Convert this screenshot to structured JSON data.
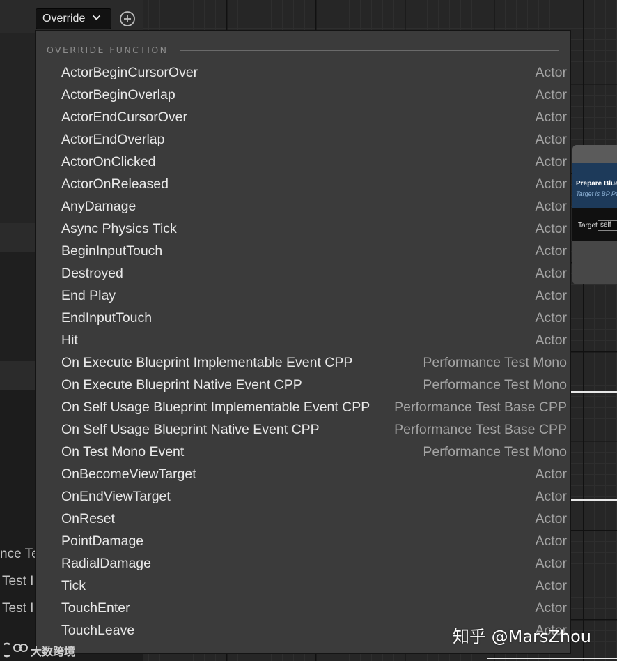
{
  "toolbar": {
    "override_label": "Override"
  },
  "menu": {
    "header": "OVERRIDE FUNCTION",
    "items": [
      {
        "name": "ActorBeginCursorOver",
        "owner": "Actor"
      },
      {
        "name": "ActorBeginOverlap",
        "owner": "Actor"
      },
      {
        "name": "ActorEndCursorOver",
        "owner": "Actor"
      },
      {
        "name": "ActorEndOverlap",
        "owner": "Actor"
      },
      {
        "name": "ActorOnClicked",
        "owner": "Actor"
      },
      {
        "name": "ActorOnReleased",
        "owner": "Actor"
      },
      {
        "name": "AnyDamage",
        "owner": "Actor"
      },
      {
        "name": "Async Physics Tick",
        "owner": "Actor"
      },
      {
        "name": "BeginInputTouch",
        "owner": "Actor"
      },
      {
        "name": "Destroyed",
        "owner": "Actor"
      },
      {
        "name": "End Play",
        "owner": "Actor"
      },
      {
        "name": "EndInputTouch",
        "owner": "Actor"
      },
      {
        "name": "Hit",
        "owner": "Actor"
      },
      {
        "name": "On Execute Blueprint Implementable Event CPP",
        "owner": "Performance Test Mono"
      },
      {
        "name": "On Execute Blueprint Native Event CPP",
        "owner": "Performance Test Mono"
      },
      {
        "name": "On Self Usage Blueprint Implementable Event CPP",
        "owner": "Performance Test Base CPP"
      },
      {
        "name": "On Self Usage Blueprint Native Event CPP",
        "owner": "Performance Test Base CPP"
      },
      {
        "name": "On Test Mono Event",
        "owner": "Performance Test Mono"
      },
      {
        "name": "OnBecomeViewTarget",
        "owner": "Actor"
      },
      {
        "name": "OnEndViewTarget",
        "owner": "Actor"
      },
      {
        "name": "OnReset",
        "owner": "Actor"
      },
      {
        "name": "PointDamage",
        "owner": "Actor"
      },
      {
        "name": "RadialDamage",
        "owner": "Actor"
      },
      {
        "name": "Tick",
        "owner": "Actor"
      },
      {
        "name": "TouchEnter",
        "owner": "Actor"
      },
      {
        "name": "TouchLeave",
        "owner": "Actor"
      }
    ]
  },
  "left_panel": {
    "line1": "nce Te",
    "line2": "Test I",
    "line3": "Test I"
  },
  "node": {
    "title": "Prepare Bluep",
    "subtitle": "Target is BP Pe",
    "target_label": "Target",
    "self_value": "self"
  },
  "watermark": {
    "right": "知乎 @MarsZhou",
    "left": "大数跨境"
  },
  "icons": {
    "dropdown": "chevron-down-icon",
    "add": "plus-circle-icon",
    "watermark_logo": "logo-icon"
  }
}
